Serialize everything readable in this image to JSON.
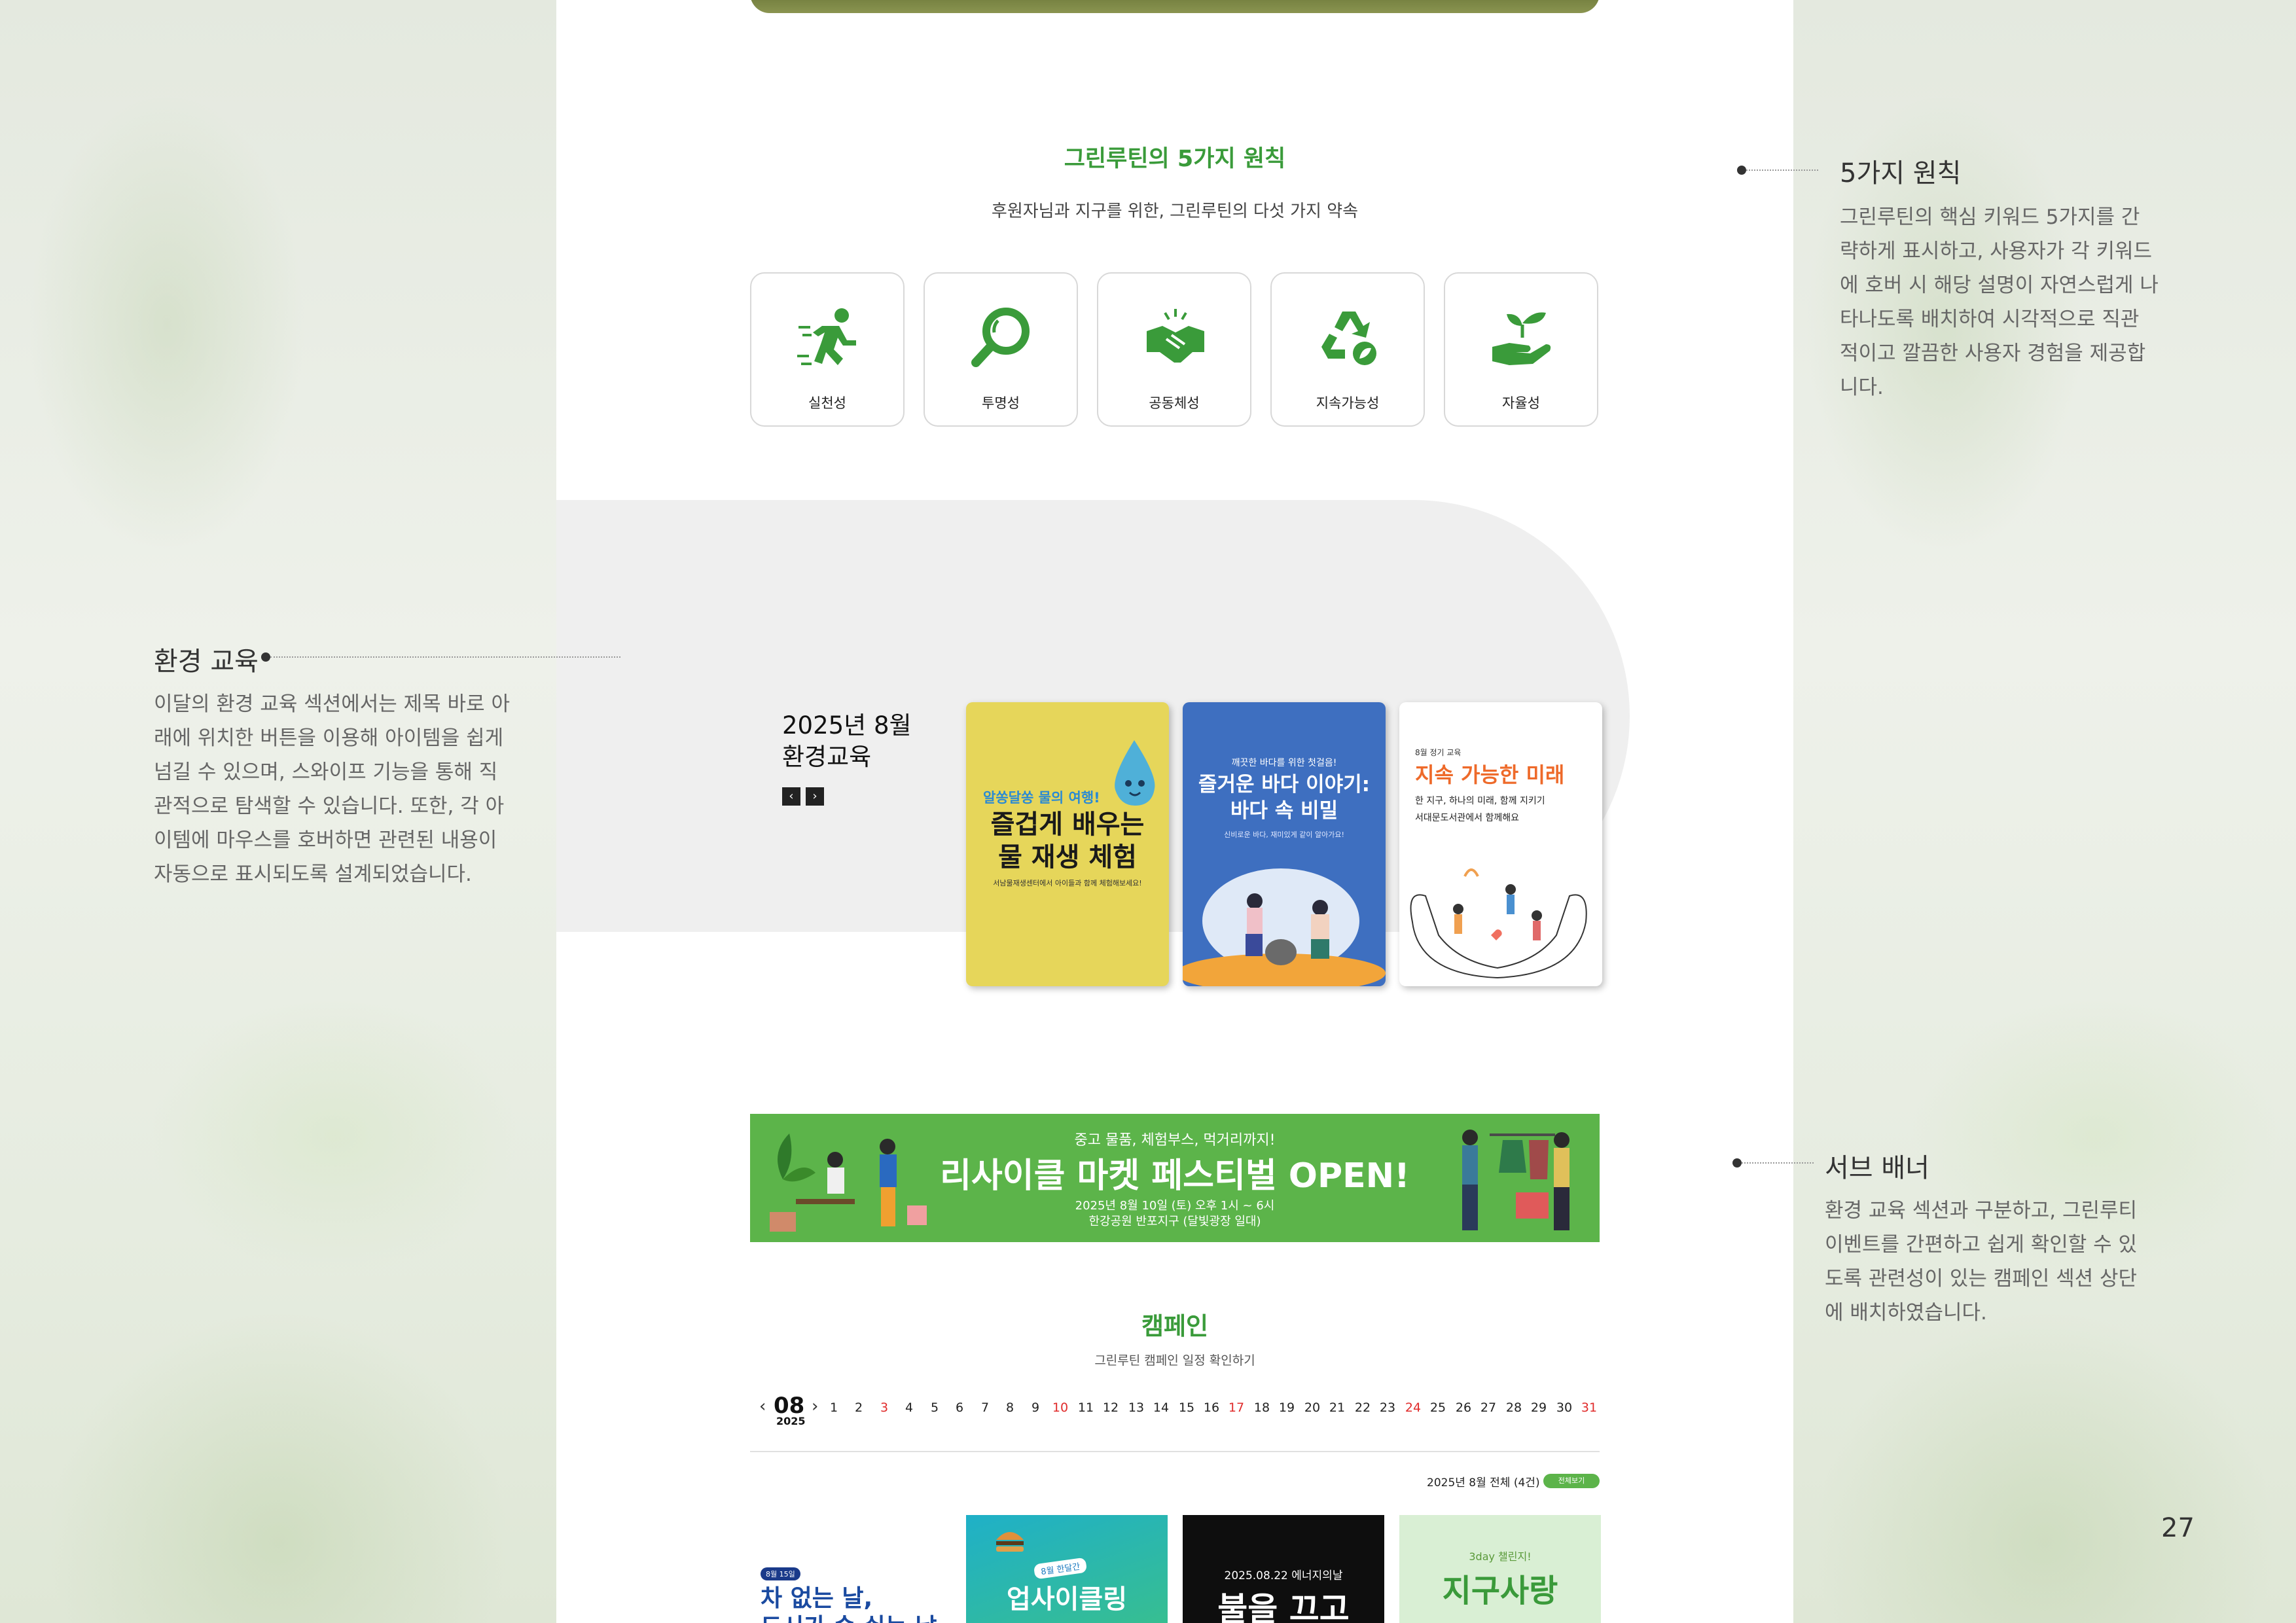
{
  "principles_section": {
    "title": "그린루틴의 5가지 원칙",
    "subtitle": "후원자님과 지구를 위한, 그린루틴의 다섯 가지 약속",
    "items": [
      {
        "label": "실천성",
        "icon": "running-person-icon"
      },
      {
        "label": "투명성",
        "icon": "magnifier-icon"
      },
      {
        "label": "공동체성",
        "icon": "handshake-icon"
      },
      {
        "label": "지속가능성",
        "icon": "recycle-icon"
      },
      {
        "label": "자율성",
        "icon": "hand-sprout-icon"
      }
    ]
  },
  "education": {
    "title_line1": "2025년 8월",
    "title_line2": "환경교육",
    "prev_icon": "chevron-left-icon",
    "next_icon": "chevron-right-icon",
    "cards": [
      {
        "tag": "알쏭달쏭 물의 여행!",
        "title_line1": "즐겁게 배우는",
        "title_line2": "물 재생 체험",
        "desc": "서남물재생센터에서 아이들과 함께 체험해보세요!",
        "bg": "#e6d65a"
      },
      {
        "tag": "깨끗한 바다를 위한 첫걸음!",
        "title_line1": "즐거운 바다 이야기:",
        "title_line2": "바다 속 비밀",
        "desc": "신비로운 바다, 재미있게 같이 알아가요!",
        "bg": "#3e6fc0"
      },
      {
        "tag": "8월 정기 교육",
        "title_line1": "지속 가능한 미래",
        "desc_line1": "한 지구, 하나의 미래, 함께 지키기",
        "desc_line2": "서대문도서관에서 함께해요",
        "bg": "#ffffff"
      }
    ]
  },
  "banner": {
    "top": "중고 물품, 체험부스, 먹거리까지!",
    "headline": "리사이클 마켓 페스티벌 OPEN!",
    "date": "2025년 8월 10일 (토) 오후 1시 ~ 6시",
    "place": "한강공원 반포지구 (달빛광장 일대)",
    "color": "#5cb44a"
  },
  "campaign": {
    "title": "캠페인",
    "subtitle": "그린루틴 캠페인 일정 확인하기",
    "month": "08",
    "year": "2025",
    "days": [
      "1",
      "2",
      "3",
      "4",
      "5",
      "6",
      "7",
      "8",
      "9",
      "10",
      "11",
      "12",
      "13",
      "14",
      "15",
      "16",
      "17",
      "18",
      "19",
      "20",
      "21",
      "22",
      "23",
      "24",
      "25",
      "26",
      "27",
      "28",
      "29",
      "30",
      "31"
    ],
    "red_days": [
      "3",
      "10",
      "17",
      "24",
      "31"
    ],
    "summary": "2025년 8월 전체 (4건)",
    "view_all": "전체보기",
    "cards": [
      {
        "badge": "8월 15일",
        "title_line1": "차 없는 날,",
        "title_line2": "도시가 숨 쉬는 날"
      },
      {
        "badge": "8월 한달간",
        "title_line1": "업사이클링"
      },
      {
        "badge": "2025.08.22 에너지의날",
        "title_line1": "불을 끄고"
      },
      {
        "badge": "3day 챌린지!",
        "title_line1": "지구사랑"
      }
    ]
  },
  "annotations": {
    "principles": {
      "title": "5가지 원칙",
      "lines": [
        "그린루틴의 핵심 키워드 5가지를 간",
        "략하게 표시하고, 사용자가 각 키워드",
        "에 호버 시 해당 설명이 자연스럽게 나",
        "타나도록 배치하여 시각적으로 직관",
        "적이고 깔끔한 사용자 경험을 제공합",
        "니다."
      ]
    },
    "education": {
      "title": "환경 교육",
      "lines": [
        "이달의 환경 교육 섹션에서는 제목 바로 아",
        "래에 위치한 버튼을 이용해 아이템을 쉽게",
        "넘길 수 있으며, 스와이프 기능을 통해 직",
        "관적으로 탐색할 수 있습니다. 또한, 각 아",
        "이템에 마우스를 호버하면 관련된 내용이",
        "자동으로 표시되도록 설계되었습니다."
      ]
    },
    "sub_banner": {
      "title": "서브 배너",
      "lines": [
        "환경 교육 섹션과 구분하고, 그린루티",
        "이벤트를 간편하고 쉽게 확인할 수 있",
        "도록 관련성이 있는 캠페인 섹션 상단",
        "에 배치하였습니다."
      ]
    }
  },
  "page_number": "27",
  "colors": {
    "accent_green": "#3a9b3a",
    "red_day": "#e02b2b"
  }
}
